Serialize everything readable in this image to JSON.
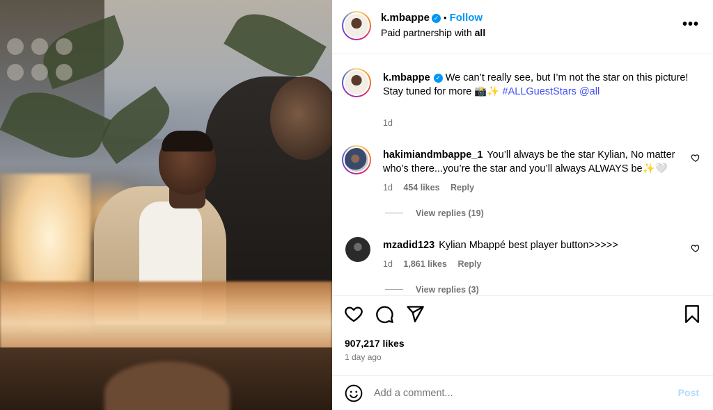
{
  "post": {
    "username": "k.mbappe",
    "follow_label": "Follow",
    "separator": "•",
    "partnership_prefix": "Paid partnership with",
    "partner": "all",
    "more_label": "•••",
    "caption": {
      "username": "k.mbappe",
      "text": "We can’t really see, but I’m not the star on this picture!",
      "line2": "Stay tuned for more 📸✨",
      "hashtag": "#ALLGuestStars",
      "mention": "@all",
      "age": "1d"
    }
  },
  "comments": [
    {
      "username": "hakimiandmbappe_1",
      "text": "You’ll always be the star Kylian, No matter who’s there...you’re the star and you’ll always ALWAYS be✨🤍",
      "age": "1d",
      "likes": "454 likes",
      "reply_label": "Reply",
      "view_replies": "View replies (19)"
    },
    {
      "username": "mzadid123",
      "text": "Kylian Mbappé best player button>>>>>",
      "age": "1d",
      "likes": "1,861 likes",
      "reply_label": "Reply",
      "view_replies": "View replies (3)"
    }
  ],
  "engagement": {
    "likes": "907,217 likes",
    "time": "1 day ago"
  },
  "composer": {
    "placeholder": "Add a comment...",
    "post_label": "Post"
  },
  "icons": {
    "like": "heart-icon",
    "comment": "comment-bubble-icon",
    "share": "paper-plane-icon",
    "save": "bookmark-icon",
    "emoji": "smiley-icon",
    "verified": "verified-badge-icon"
  },
  "colors": {
    "accent": "#0095f6",
    "hashtag": "#4150f7",
    "muted": "#737373",
    "post_disabled": "#b3dbff"
  }
}
